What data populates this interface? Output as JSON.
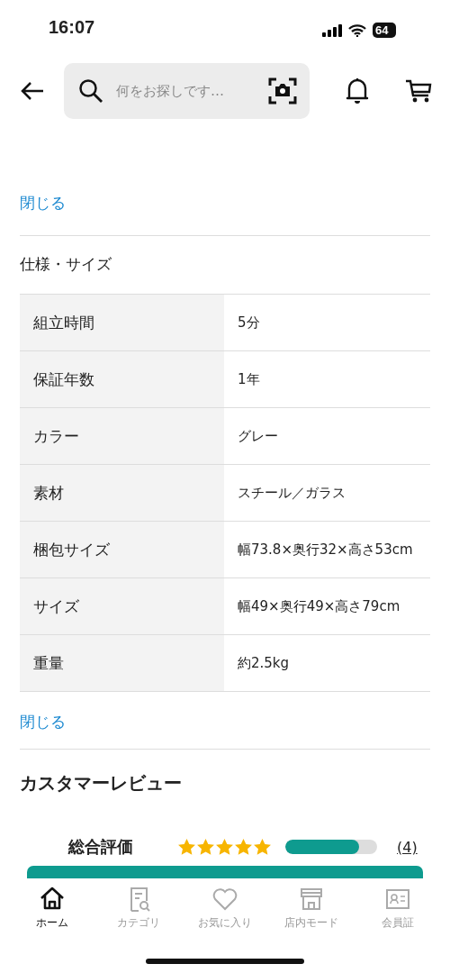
{
  "status_bar": {
    "time": "16:07",
    "battery": "64"
  },
  "header": {
    "search": {
      "placeholder": "何をお探しです…"
    }
  },
  "spec_section": {
    "close_top": "閉じる",
    "title": "仕様・サイズ",
    "rows": [
      {
        "label": "組立時間",
        "value": "5分"
      },
      {
        "label": "保証年数",
        "value": "1年"
      },
      {
        "label": "カラー",
        "value": "グレー"
      },
      {
        "label": "素材",
        "value": "スチール／ガラス"
      },
      {
        "label": "梱包サイズ",
        "value": "幅73.8×奥行32×高さ53cm"
      },
      {
        "label": "サイズ",
        "value": "幅49×奥行49×高さ79cm"
      },
      {
        "label": "重量",
        "value": "約2.5kg"
      }
    ],
    "close_bottom": "閉じる"
  },
  "reviews": {
    "title": "カスタマーレビュー",
    "overall_label": "総合評価",
    "stars": 5,
    "level": 0.8,
    "count": "(4)"
  },
  "tab_bar": [
    {
      "label": "ホーム",
      "selected": true
    },
    {
      "label": "カテゴリ",
      "selected": false
    },
    {
      "label": "お気に入り",
      "selected": false
    },
    {
      "label": "店内モード",
      "selected": false
    },
    {
      "label": "会員証",
      "selected": false
    }
  ]
}
